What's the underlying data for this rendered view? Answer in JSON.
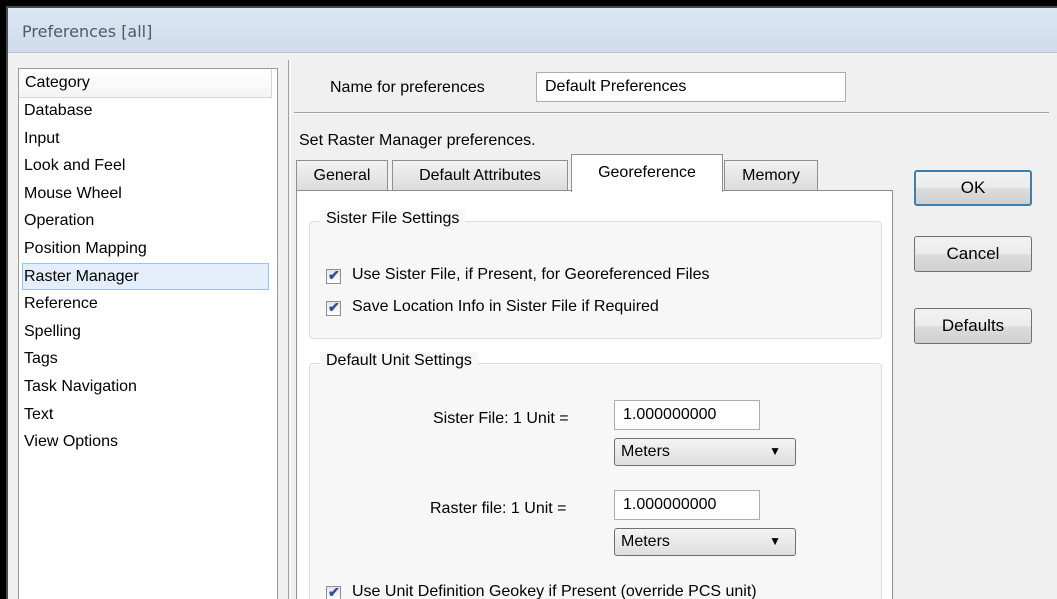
{
  "window": {
    "title": "Preferences [all]"
  },
  "sidebar": {
    "header": "Category",
    "items": [
      {
        "label": "Database"
      },
      {
        "label": "Input"
      },
      {
        "label": "Look and Feel"
      },
      {
        "label": "Mouse Wheel"
      },
      {
        "label": "Operation"
      },
      {
        "label": "Position Mapping"
      },
      {
        "label": "Raster Manager",
        "selected": true
      },
      {
        "label": "Reference"
      },
      {
        "label": "Spelling"
      },
      {
        "label": "Tags"
      },
      {
        "label": "Task Navigation"
      },
      {
        "label": "Text"
      },
      {
        "label": "View Options"
      }
    ]
  },
  "name_field": {
    "label": "Name for preferences",
    "value": "Default Preferences"
  },
  "section_label": "Set Raster Manager preferences.",
  "tabs": [
    {
      "label": "General"
    },
    {
      "label": "Default Attributes"
    },
    {
      "label": "Georeference",
      "active": true
    },
    {
      "label": "Memory"
    }
  ],
  "sister_group": {
    "title": "Sister File Settings",
    "use_sister": {
      "label": "Use Sister File, if Present, for Georeferenced Files",
      "checked": true
    },
    "save_location": {
      "label": "Save Location Info in Sister File if Required",
      "checked": true
    }
  },
  "unit_group": {
    "title": "Default Unit Settings",
    "sister_unit": {
      "label": "Sister File: 1 Unit =",
      "value": "1.000000000",
      "unit": "Meters"
    },
    "raster_unit": {
      "label": "Raster file: 1 Unit =",
      "value": "1.000000000",
      "unit": "Meters"
    },
    "use_geokey": {
      "label": "Use Unit Definition Geokey if Present (override PCS unit)",
      "checked": true
    }
  },
  "buttons": {
    "ok": "OK",
    "cancel": "Cancel",
    "defaults": "Defaults"
  },
  "colors": {
    "selection_bg": "#e4eefa",
    "selection_border": "#9fc2ea",
    "default_button_border": "#3c7fb1"
  }
}
